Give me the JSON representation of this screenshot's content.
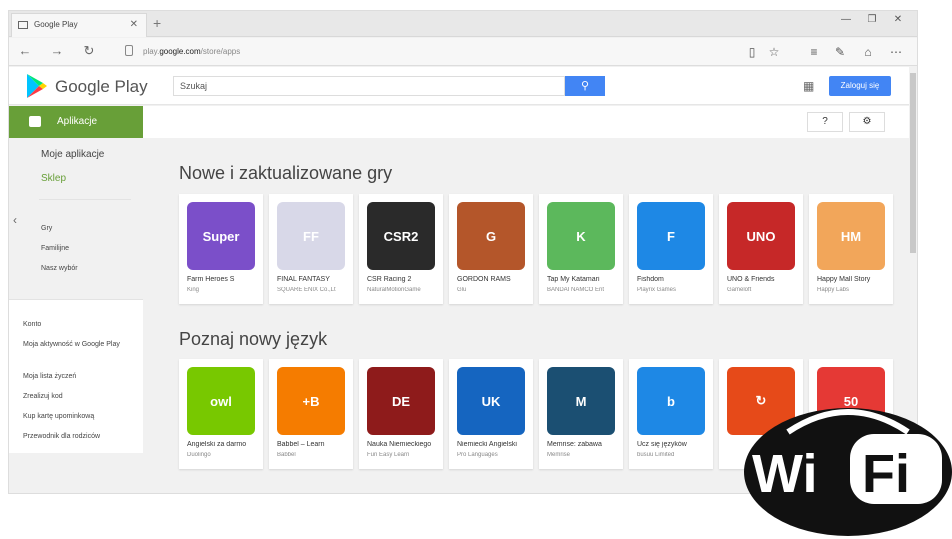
{
  "browser": {
    "tab_title": "Google Play",
    "url_prefix": "play.",
    "url_domain": "google.com",
    "url_path": "/store/apps"
  },
  "header": {
    "logo_text": "Google Play",
    "search_placeholder": "Szukaj",
    "signin_label": "Zaloguj się"
  },
  "sidebar": {
    "apps_label": "Aplikacje",
    "my_apps": "Moje aplikacje",
    "store": "Sklep",
    "categories": [
      "Gry",
      "Familijne",
      "Nasz wybór"
    ],
    "account": [
      "Konto",
      "Moja aktywność w Google Play",
      "Moja lista życzeń",
      "Zrealizuj kod",
      "Kup kartę upominkową",
      "Przewodnik dla rodziców"
    ]
  },
  "sections": [
    {
      "title": "Nowe i zaktualizowane gry",
      "apps": [
        {
          "name": "Farm Heroes S",
          "dev": "King",
          "icon": "Super",
          "color": "#7b4fc9"
        },
        {
          "name": "FINAL FANTASY",
          "dev": "SQUARE ENIX Co.,Lt",
          "icon": "FF",
          "color": "#d8d8e8"
        },
        {
          "name": "CSR Racing 2",
          "dev": "NaturalMotionGame",
          "icon": "CSR2",
          "color": "#2a2a2a"
        },
        {
          "name": "GORDON RAMS",
          "dev": "Glu",
          "icon": "G",
          "color": "#b4562a"
        },
        {
          "name": "Tap My Katamari",
          "dev": "BANDAI NAMCO Ent",
          "icon": "K",
          "color": "#5cb85c"
        },
        {
          "name": "Fishdom",
          "dev": "Playrix Games",
          "icon": "F",
          "color": "#1e88e5"
        },
        {
          "name": "UNO & Friends",
          "dev": "Gameloft",
          "icon": "UNO",
          "color": "#c62828"
        },
        {
          "name": "Happy Mall Story",
          "dev": "Happy Labs",
          "icon": "HM",
          "color": "#f2a65a"
        }
      ]
    },
    {
      "title": "Poznaj nowy język",
      "apps": [
        {
          "name": "Angielski za darmo",
          "dev": "Duolingo",
          "icon": "owl",
          "color": "#78c800"
        },
        {
          "name": "Babbel – Learn",
          "dev": "Babbel",
          "icon": "+B",
          "color": "#f57c00"
        },
        {
          "name": "Nauka Niemieckiego",
          "dev": "Fun Easy Learn",
          "icon": "DE",
          "color": "#8e1b1b"
        },
        {
          "name": "Niemiecki Angielski",
          "dev": "Pro Languages",
          "icon": "UK",
          "color": "#1565c0"
        },
        {
          "name": "Memrise: zabawa",
          "dev": "Memrise",
          "icon": "M",
          "color": "#1b4f72"
        },
        {
          "name": "Ucz się języków",
          "dev": "busuu Limited",
          "icon": "b",
          "color": "#1e88e5"
        },
        {
          "name": "",
          "dev": "",
          "icon": "↻",
          "color": "#e64a19"
        },
        {
          "name": "",
          "dev": "",
          "icon": "50",
          "color": "#e53935"
        }
      ]
    }
  ],
  "watermark": {
    "left": "Wi",
    "right": "Fi"
  }
}
